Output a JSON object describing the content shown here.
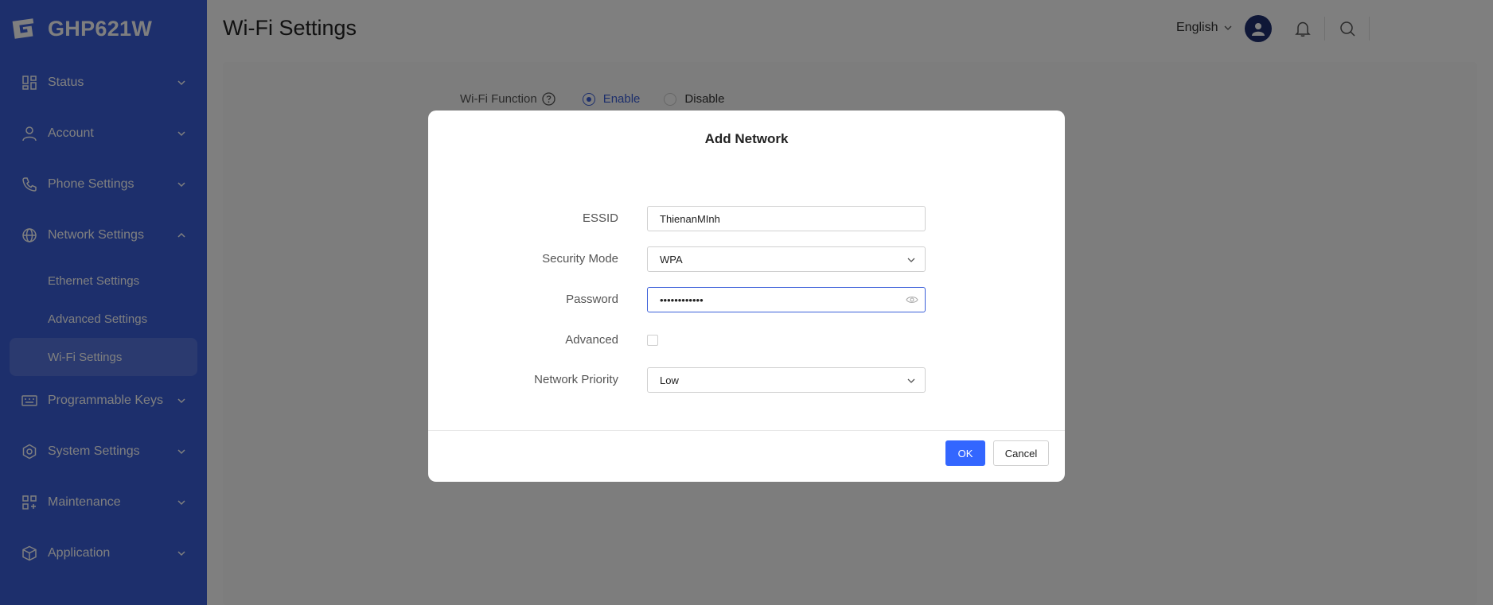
{
  "sidebar": {
    "brand": "GHP621W",
    "items": [
      {
        "label": "Status",
        "icon": "status-grid-icon",
        "expanded": false
      },
      {
        "label": "Account",
        "icon": "account-user-icon",
        "expanded": false
      },
      {
        "label": "Phone Settings",
        "icon": "phone-icon",
        "expanded": false
      },
      {
        "label": "Network Settings",
        "icon": "globe-icon",
        "expanded": true
      },
      {
        "label": "Programmable Keys",
        "icon": "keyboard-icon",
        "expanded": false
      },
      {
        "label": "System Settings",
        "icon": "gear-icon",
        "expanded": false
      },
      {
        "label": "Maintenance",
        "icon": "maintenance-grid-icon",
        "expanded": false
      },
      {
        "label": "Application",
        "icon": "cube-icon",
        "expanded": false
      }
    ],
    "network_subitems": [
      {
        "label": "Ethernet Settings",
        "active": false
      },
      {
        "label": "Advanced Settings",
        "active": false
      },
      {
        "label": "Wi-Fi Settings",
        "active": true
      }
    ]
  },
  "header": {
    "title": "Wi-Fi Settings",
    "language": "English"
  },
  "wifi_function": {
    "label": "Wi-Fi Function",
    "enable_label": "Enable",
    "disable_label": "Disable",
    "selected": "Enable"
  },
  "modal": {
    "title": "Add Network",
    "fields": {
      "essid_label": "ESSID",
      "essid_value": "ThienanMInh",
      "security_label": "Security Mode",
      "security_value": "WPA",
      "password_label": "Password",
      "password_value": "••••••••••••",
      "advanced_label": "Advanced",
      "priority_label": "Network Priority",
      "priority_value": "Low"
    },
    "ok_label": "OK",
    "cancel_label": "Cancel"
  },
  "colors": {
    "sidebar_bg": "#3b5fd9",
    "accent": "#3366ff",
    "avatar_bg": "#1f2e6e"
  }
}
